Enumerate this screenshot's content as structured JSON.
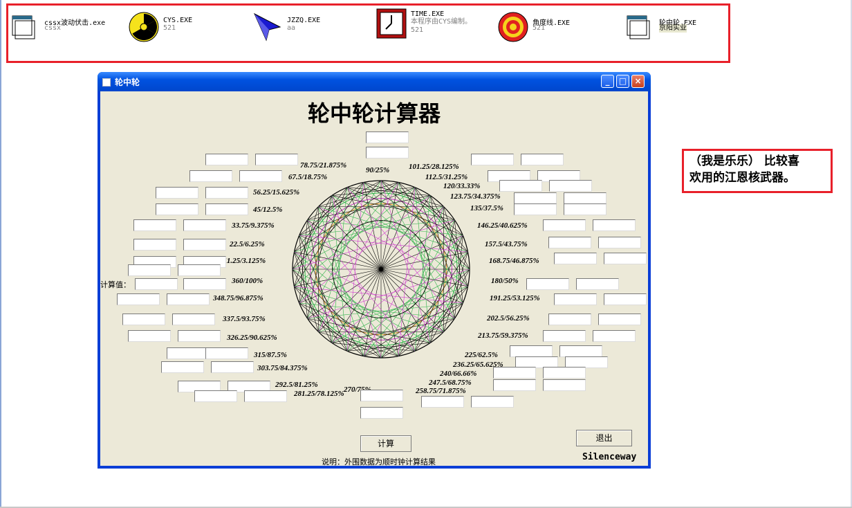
{
  "desktop_icons": [
    {
      "name": "cssx波动伏击.exe",
      "desc": "cssx",
      "icon": "window-app-icon"
    },
    {
      "name": "CYS.EXE",
      "desc": "521",
      "icon": "radiation-icon"
    },
    {
      "name": "JZZQ.EXE",
      "desc": "aa",
      "icon": "blue-arrow-icon"
    },
    {
      "name": "TIME.EXE",
      "desc": "本程序由CYS编制。",
      "desc2": "521",
      "icon": "clock-icon"
    },
    {
      "name": "角度线.EXE",
      "desc": "521",
      "icon": "target-icon"
    },
    {
      "name": "轮中轮.EXE",
      "desc": "京阳实业",
      "icon": "window-app-icon"
    }
  ],
  "note": {
    "line1": "（我是乐乐） 比较喜",
    "line2": "欢用的江恩核武器。"
  },
  "window": {
    "title": "轮中轮",
    "heading": "轮中轮计算器",
    "calc_label": "计算值：",
    "calc_button": "计算",
    "exit_button": "退出",
    "footer": "说明：外围数据为顺时钟计算结果",
    "brand": "Silenceway",
    "angle_labels": [
      "90/25%",
      "101.25/28.125%",
      "112.5/31.25%",
      "120/33.33%",
      "123.75/34.375%",
      "135/37.5%",
      "146.25/40.625%",
      "157.5/43.75%",
      "168.75/46.875%",
      "180/50%",
      "191.25/53.125%",
      "202.5/56.25%",
      "213.75/59.375%",
      "225/62.5%",
      "236.25/65.625%",
      "240/66.66%",
      "247.5/68.75%",
      "258.75/71.875%",
      "270/75%",
      "281.25/78.125%",
      "292.5/81.25%",
      "303.75/84.375%",
      "315/87.5%",
      "326.25/90.625%",
      "337.5/93.75%",
      "348.75/96.875%",
      "360/100%",
      "11.25/3.125%",
      "22.5/6.25%",
      "33.75/9.375%",
      "45/12.5%",
      "56.25/15.625%",
      "67.5/18.75%",
      "78.75/21.875%"
    ]
  },
  "colors": {
    "frame_red": "#e8202a",
    "xp_blue": "#0a3ed6",
    "window_bg": "#ece9d8",
    "wheel_green": "#2fb24a",
    "wheel_magenta": "#d03ad0",
    "wheel_orange": "#e0a030"
  }
}
